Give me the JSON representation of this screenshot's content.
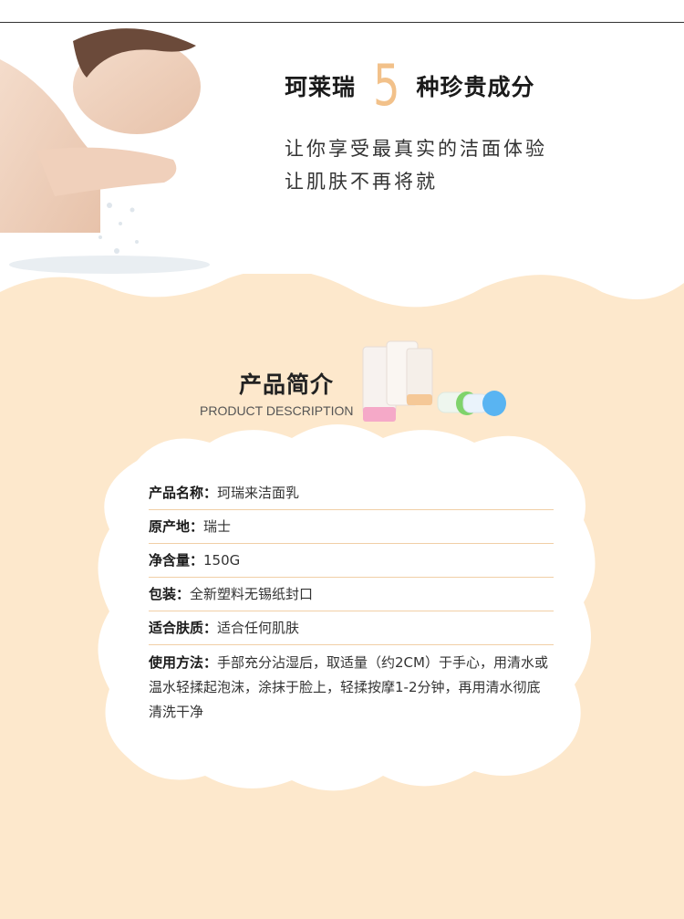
{
  "hero": {
    "brand": "珂莱瑞",
    "number": "5",
    "headline_rest": "种珍贵成分",
    "sub_line_1": "让你享受最真实的洁面体验",
    "sub_line_2": "让肌肤不再将就"
  },
  "section": {
    "title": "产品简介",
    "subtitle": "PRODUCT DESCRIPTION"
  },
  "info": [
    {
      "label": "产品名称：",
      "value": "珂瑞来洁面乳"
    },
    {
      "label": "原产地：",
      "value": "瑞士"
    },
    {
      "label": "净含量：",
      "value": "150G"
    },
    {
      "label": "包装：",
      "value": "全新塑料无锡纸封口"
    },
    {
      "label": "适合肤质：",
      "value": "适合任何肌肤"
    },
    {
      "label": "使用方法：",
      "value": "手部充分沾湿后，取适量（约2CM）于手心，用清水或温水轻揉起泡沫，涂抹于脸上，轻揉按摩1-2分钟，再用清水彻底清洗干净"
    }
  ],
  "colors": {
    "cream": "#fde8cc",
    "accent_orange": "#f2c18a",
    "divider": "#f1cfa6"
  }
}
